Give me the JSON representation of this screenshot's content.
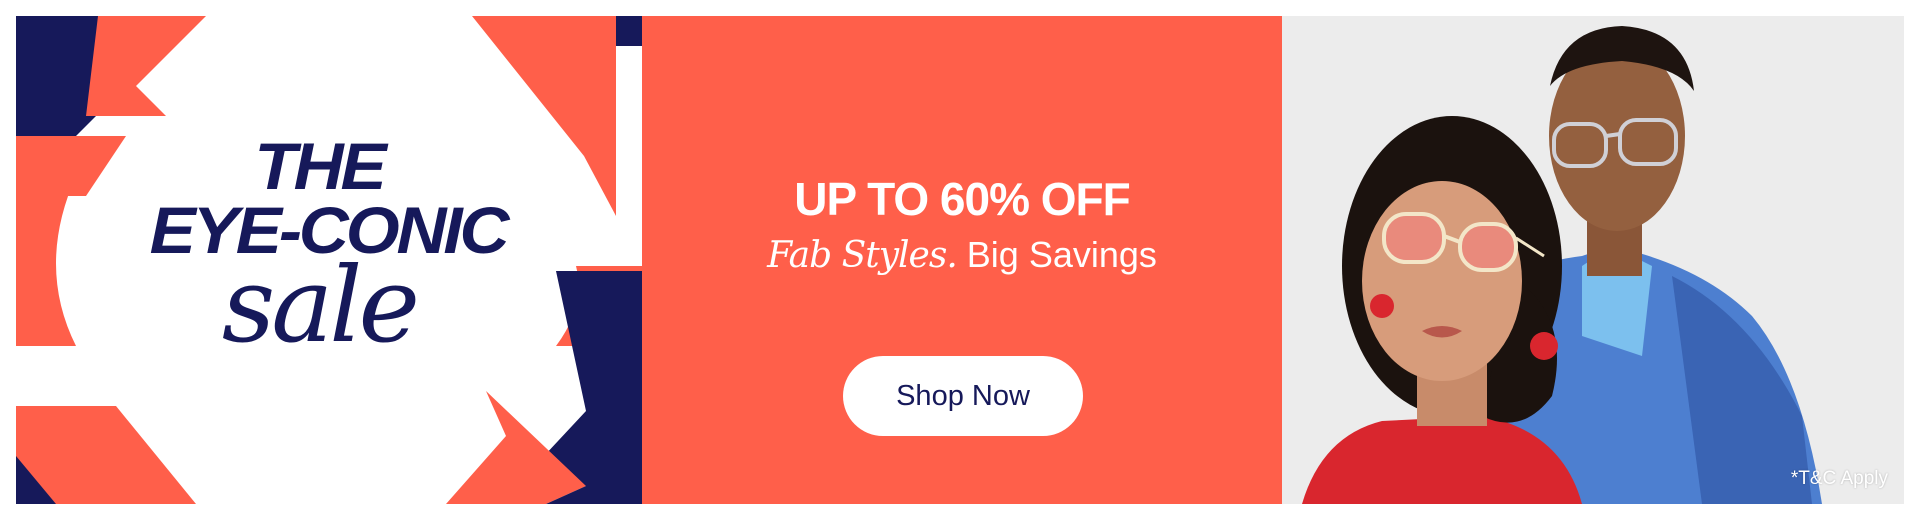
{
  "colors": {
    "navy": "#16195a",
    "coral": "#ff5f4a",
    "white": "#ffffff",
    "photo_bg": "#ececec"
  },
  "headline": {
    "line1": "THE",
    "line2": "EYE-CONIC",
    "line3": "sale"
  },
  "offer": {
    "title": "UP TO 60% OFF",
    "subtitle_italic": "Fab Styles.",
    "subtitle_plain": "Big Savings",
    "button_label": "Shop Now"
  },
  "photo": {
    "terms_note": "*T&C Apply"
  }
}
